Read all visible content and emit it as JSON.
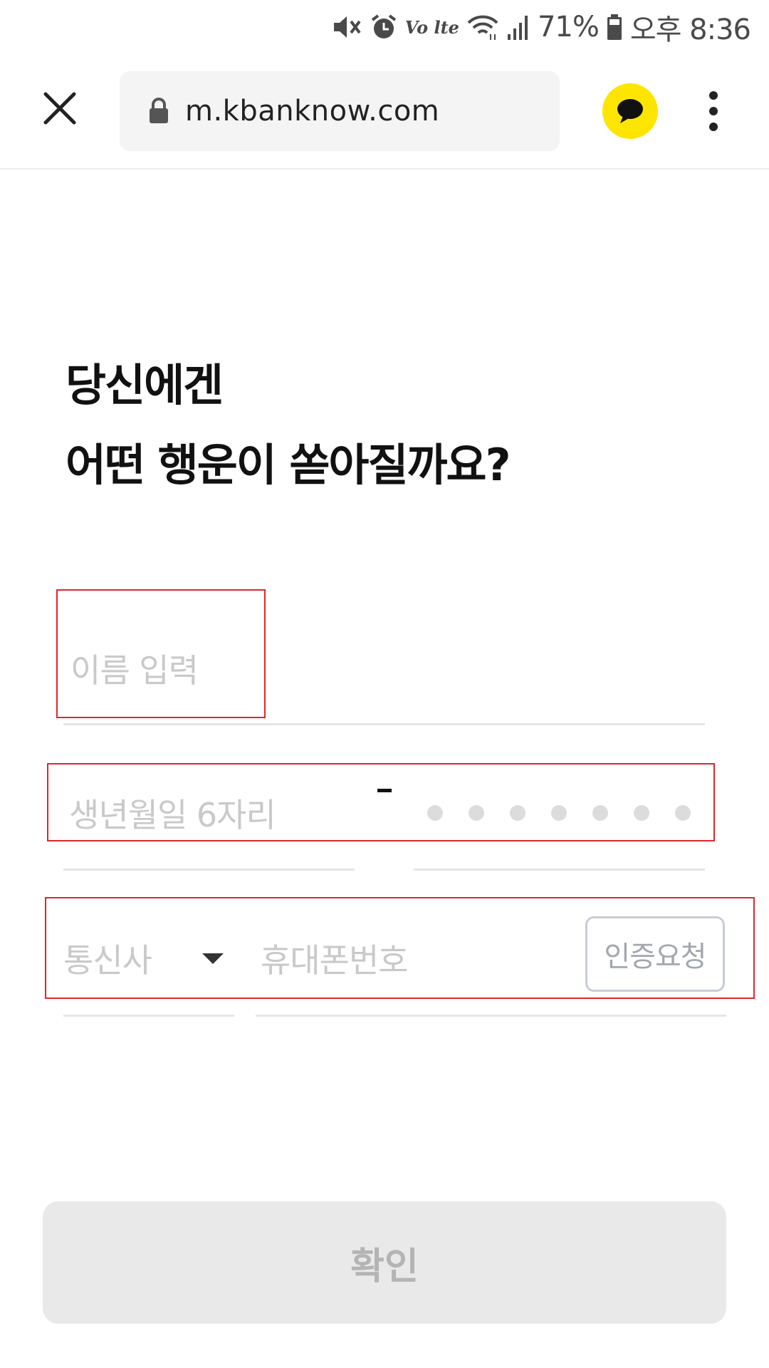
{
  "status_bar": {
    "network_label": "Vo lte",
    "battery_percent": "71%",
    "time": "오후 8:36",
    "icons": [
      "mute-icon",
      "alarm-icon",
      "volte-icon",
      "wifi-icon",
      "signal-icon",
      "battery-icon"
    ]
  },
  "browser": {
    "url": "m.kbanknow.com",
    "icons": [
      "close-icon",
      "lock-icon",
      "kakaotalk-icon",
      "more-vert-icon"
    ],
    "kakao_color": "#fee500"
  },
  "heading": {
    "line1": "당신에겐",
    "line2": "어떤 행운이 쏟아질까요?"
  },
  "form": {
    "name_placeholder": "이름 입력",
    "birth_placeholder": "생년월일 6자리",
    "rrn_masked_digits": 7,
    "carrier_placeholder": "통신사",
    "phone_placeholder": "휴대폰번호",
    "verify_button": "인증요청",
    "highlight_color": "#e0262c"
  },
  "confirm_button": "확인"
}
